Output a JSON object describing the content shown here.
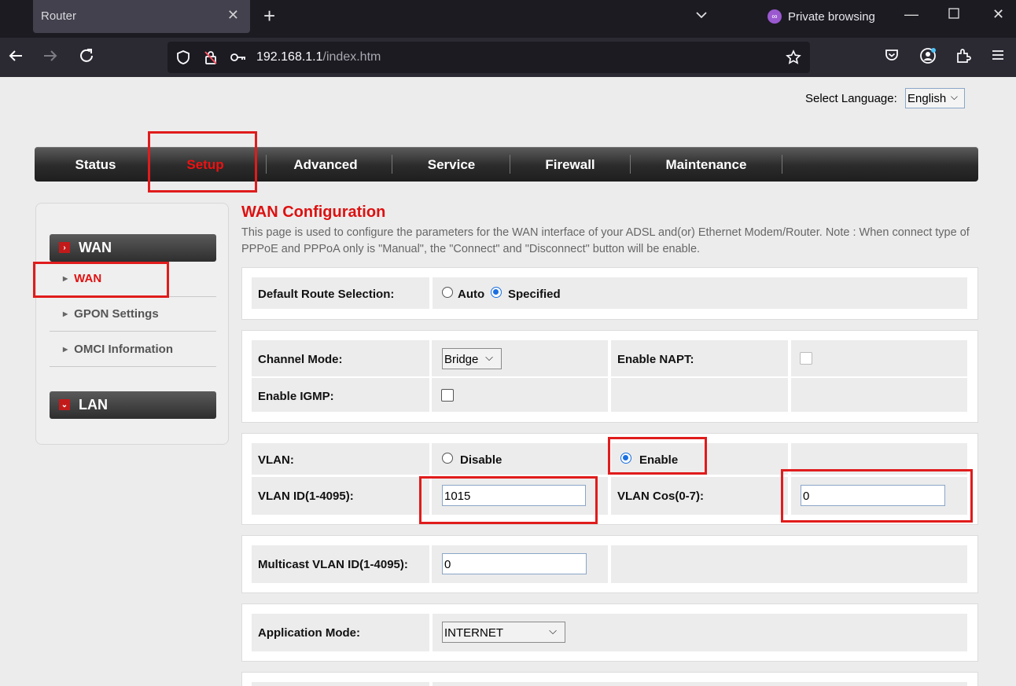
{
  "browser": {
    "tab_title": "Router",
    "private_label": "Private browsing",
    "url_host": "192.168.1.1",
    "url_path": "/index.htm"
  },
  "language": {
    "label": "Select Language:",
    "value": "English"
  },
  "menu": [
    "Status",
    "Setup",
    "Advanced",
    "Service",
    "Firewall",
    "Maintenance"
  ],
  "sidebar": {
    "wan_header": "WAN",
    "items": [
      "WAN",
      "GPON Settings",
      "OMCI Information"
    ],
    "lan_header": "LAN"
  },
  "content": {
    "title": "WAN Configuration",
    "description": "This page is used to configure the parameters for the WAN interface of your ADSL and(or) Ethernet Modem/Router. Note : When connect type of PPPoE and PPPoA only is \"Manual\", the \"Connect\" and \"Disconnect\" button will be enable.",
    "default_route": {
      "label": "Default Route Selection:",
      "opt_auto": "Auto",
      "opt_specified": "Specified"
    },
    "channel_mode": {
      "label": "Channel Mode:",
      "value": "Bridge"
    },
    "enable_napt": {
      "label": "Enable NAPT:"
    },
    "enable_igmp": {
      "label": "Enable IGMP:"
    },
    "vlan": {
      "label": "VLAN:",
      "opt_disable": "Disable",
      "opt_enable": "Enable"
    },
    "vlan_id": {
      "label": "VLAN ID(1-4095):",
      "value": "1015"
    },
    "vlan_cos": {
      "label": "VLAN Cos(0-7):",
      "value": "0"
    },
    "mcast_vlan": {
      "label": "Multicast VLAN ID(1-4095):",
      "value": "0"
    },
    "app_mode": {
      "label": "Application Mode:",
      "value": "INTERNET"
    }
  }
}
